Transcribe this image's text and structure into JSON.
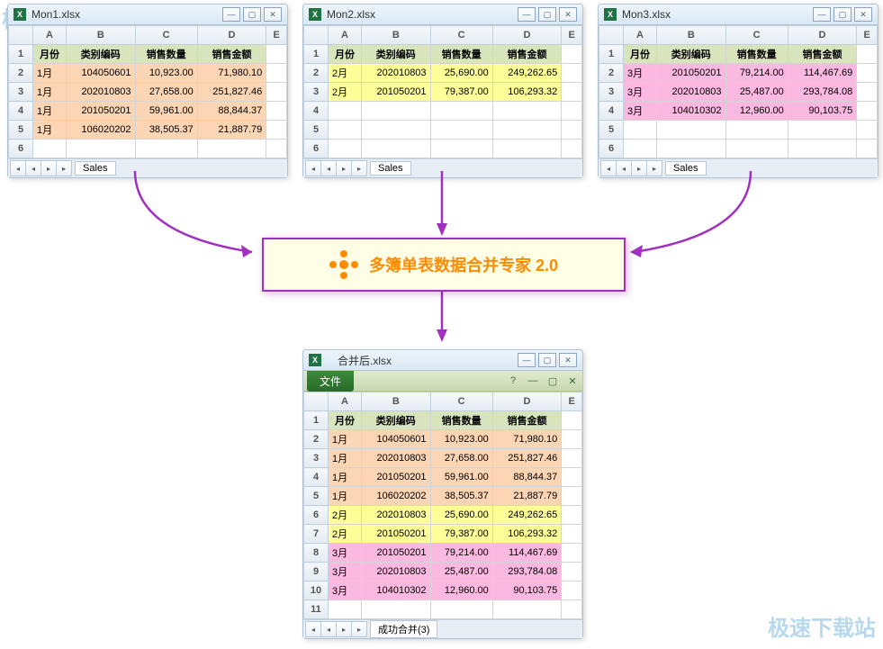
{
  "watermark": "极速下载站",
  "center": {
    "title": "多簿单表数据合并专家 2.0"
  },
  "cols": [
    "A",
    "B",
    "C",
    "D",
    "E"
  ],
  "headers": [
    "月份",
    "类别编码",
    "销售数量",
    "销售金额"
  ],
  "w1": {
    "title": "Mon1.xlsx",
    "sheet": "Sales",
    "rows": [
      [
        "1月",
        "104050601",
        "10,923.00",
        "71,980.10"
      ],
      [
        "1月",
        "202010803",
        "27,658.00",
        "251,827.46"
      ],
      [
        "1月",
        "201050201",
        "59,961.00",
        "88,844.37"
      ],
      [
        "1月",
        "106020202",
        "38,505.37",
        "21,887.79"
      ]
    ]
  },
  "w2": {
    "title": "Mon2.xlsx",
    "sheet": "Sales",
    "rows": [
      [
        "2月",
        "202010803",
        "25,690.00",
        "249,262.65"
      ],
      [
        "2月",
        "201050201",
        "79,387.00",
        "106,293.32"
      ]
    ]
  },
  "w3": {
    "title": "Mon3.xlsx",
    "sheet": "Sales",
    "rows": [
      [
        "3月",
        "201050201",
        "79,214.00",
        "114,467.69"
      ],
      [
        "3月",
        "202010803",
        "25,487.00",
        "293,784.08"
      ],
      [
        "3月",
        "104010302",
        "12,960.00",
        "90,103.75"
      ]
    ]
  },
  "w4": {
    "title": "合并后.xlsx",
    "file_btn": "文件",
    "sheet": "成功合并(3)",
    "rows": [
      {
        "c": "r1",
        "d": [
          "1月",
          "104050601",
          "10,923.00",
          "71,980.10"
        ]
      },
      {
        "c": "r1",
        "d": [
          "1月",
          "202010803",
          "27,658.00",
          "251,827.46"
        ]
      },
      {
        "c": "r1",
        "d": [
          "1月",
          "201050201",
          "59,961.00",
          "88,844.37"
        ]
      },
      {
        "c": "r1",
        "d": [
          "1月",
          "106020202",
          "38,505.37",
          "21,887.79"
        ]
      },
      {
        "c": "r2",
        "d": [
          "2月",
          "202010803",
          "25,690.00",
          "249,262.65"
        ]
      },
      {
        "c": "r2",
        "d": [
          "2月",
          "201050201",
          "79,387.00",
          "106,293.32"
        ]
      },
      {
        "c": "r3",
        "d": [
          "3月",
          "201050201",
          "79,214.00",
          "114,467.69"
        ]
      },
      {
        "c": "r3",
        "d": [
          "3月",
          "202010803",
          "25,487.00",
          "293,784.08"
        ]
      },
      {
        "c": "r3",
        "d": [
          "3月",
          "104010302",
          "12,960.00",
          "90,103.75"
        ]
      }
    ]
  }
}
